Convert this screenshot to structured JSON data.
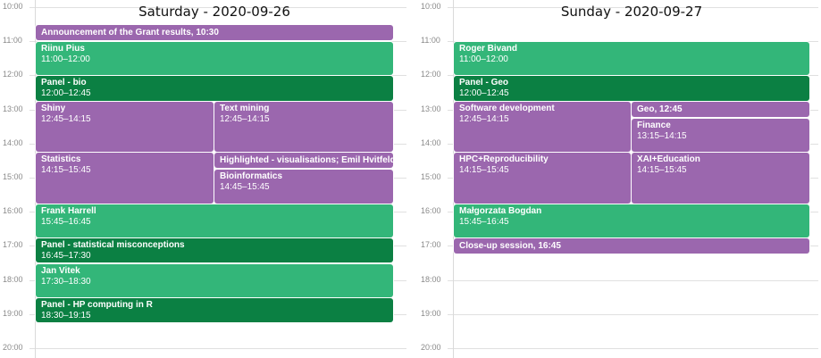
{
  "colors": {
    "purple": "#9b67ae",
    "green": "#33b679",
    "darkgreen": "#0b8043"
  },
  "hours": [
    "10:00",
    "11:00",
    "12:00",
    "13:00",
    "14:00",
    "15:00",
    "16:00",
    "17:00",
    "18:00",
    "19:00",
    "20:00"
  ],
  "days": [
    {
      "title": "Saturday - 2020-09-26",
      "events": [
        {
          "title": "Announcement of the Grant results, 10:30",
          "time": "",
          "start": 10.5,
          "end": null,
          "color": "purple"
        },
        {
          "title": "Riinu Pius",
          "time": "11:00–12:00",
          "start": 11,
          "end": 12,
          "color": "green"
        },
        {
          "title": "Panel - bio",
          "time": "12:00–12:45",
          "start": 12,
          "end": 12.75,
          "color": "darkgreen"
        },
        {
          "title": "Shiny",
          "time": "12:45–14:15",
          "start": 12.75,
          "end": 14.25,
          "color": "purple"
        },
        {
          "title": "Text mining",
          "time": "12:45–14:15",
          "start": 12.75,
          "end": 14.25,
          "color": "purple"
        },
        {
          "title": "Statistics",
          "time": "14:15–15:45",
          "start": 14.25,
          "end": 15.75,
          "color": "purple"
        },
        {
          "title": "Highlighted - visualisations; Emil Hvitfeldt,",
          "time": "",
          "start": 14.25,
          "end": null,
          "color": "purple"
        },
        {
          "title": "Bioinformatics",
          "time": "14:45–15:45",
          "start": 14.75,
          "end": 15.75,
          "color": "purple"
        },
        {
          "title": "Frank Harrell",
          "time": "15:45–16:45",
          "start": 15.75,
          "end": 16.75,
          "color": "green"
        },
        {
          "title": "Panel - statistical misconceptions",
          "time": "16:45–17:30",
          "start": 16.75,
          "end": 17.5,
          "color": "darkgreen"
        },
        {
          "title": "Jan Vitek",
          "time": "17:30–18:30",
          "start": 17.5,
          "end": 18.5,
          "color": "green"
        },
        {
          "title": "Panel - HP computing in R",
          "time": "18:30–19:15",
          "start": 18.5,
          "end": 19.25,
          "color": "darkgreen"
        }
      ]
    },
    {
      "title": "Sunday - 2020-09-27",
      "events": [
        {
          "title": "Roger Bivand",
          "time": "11:00–12:00",
          "start": 11,
          "end": 12,
          "color": "green"
        },
        {
          "title": "Panel - Geo",
          "time": "12:00–12:45",
          "start": 12,
          "end": 12.75,
          "color": "darkgreen"
        },
        {
          "title": "Software development",
          "time": "12:45–14:15",
          "start": 12.75,
          "end": 14.25,
          "color": "purple"
        },
        {
          "title": "Geo, 12:45",
          "time": "",
          "start": 12.75,
          "end": null,
          "color": "purple"
        },
        {
          "title": "Finance",
          "time": "13:15–14:15",
          "start": 13.25,
          "end": 14.25,
          "color": "purple"
        },
        {
          "title": "HPC+Reproducibility",
          "time": "14:15–15:45",
          "start": 14.25,
          "end": 15.75,
          "color": "purple"
        },
        {
          "title": "XAI+Education",
          "time": "14:15–15:45",
          "start": 14.25,
          "end": 15.75,
          "color": "purple"
        },
        {
          "title": "Małgorzata Bogdan",
          "time": "15:45–16:45",
          "start": 15.75,
          "end": 16.75,
          "color": "green"
        },
        {
          "title": "Close-up session, 16:45",
          "time": "",
          "start": 16.75,
          "end": null,
          "color": "purple"
        }
      ]
    }
  ]
}
